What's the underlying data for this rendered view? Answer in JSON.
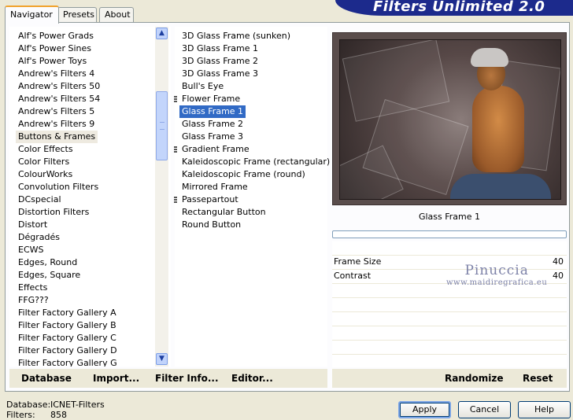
{
  "tabs": [
    {
      "label": "Navigator",
      "active": true
    },
    {
      "label": "Presets",
      "active": false
    },
    {
      "label": "About",
      "active": false
    }
  ],
  "banner": {
    "title": "Filters Unlimited 2.0"
  },
  "categories": {
    "items": [
      "Alf's Power Grads",
      "Alf's Power Sines",
      "Alf's Power Toys",
      "Andrew's Filters 4",
      "Andrew's Filters 50",
      "Andrew's Filters 54",
      "Andrew's Filters 5",
      "Andrew's Filters 9",
      "Buttons & Frames",
      "Color Effects",
      "Color Filters",
      "ColourWorks",
      "Convolution Filters",
      "DCspecial",
      "Distortion Filters",
      "Distort",
      "Dégradés",
      "ECWS",
      "Edges, Round",
      "Edges, Square",
      "Effects",
      "FFG???",
      "Filter Factory Gallery A",
      "Filter Factory Gallery B",
      "Filter Factory Gallery C",
      "Filter Factory Gallery D",
      "Filter Factory Gallery G"
    ],
    "selected": "Buttons & Frames"
  },
  "filters": {
    "items": [
      {
        "label": "3D Glass Frame (sunken)",
        "marked": false
      },
      {
        "label": "3D Glass Frame 1",
        "marked": false
      },
      {
        "label": "3D Glass Frame 2",
        "marked": false
      },
      {
        "label": "3D Glass Frame 3",
        "marked": false
      },
      {
        "label": "Bull's Eye",
        "marked": false
      },
      {
        "label": "Flower Frame",
        "marked": true
      },
      {
        "label": "Glass Frame 1",
        "marked": false
      },
      {
        "label": "Glass Frame 2",
        "marked": false
      },
      {
        "label": "Glass Frame 3",
        "marked": false
      },
      {
        "label": "Gradient Frame",
        "marked": true
      },
      {
        "label": "Kaleidoscopic Frame (rectangular)",
        "marked": false
      },
      {
        "label": "Kaleidoscopic Frame (round)",
        "marked": false
      },
      {
        "label": "Mirrored Frame",
        "marked": false
      },
      {
        "label": "Passepartout",
        "marked": true
      },
      {
        "label": "Rectangular Button",
        "marked": false
      },
      {
        "label": "Round Button",
        "marked": false
      }
    ],
    "selected": "Glass Frame 1"
  },
  "preview": {
    "filter_name": "Glass Frame 1"
  },
  "params": [
    {
      "label": "Frame Size",
      "value": "40"
    },
    {
      "label": "Contrast",
      "value": "40"
    }
  ],
  "watermark": {
    "line1": "Pinuccia",
    "line2": "www.maidiregrafica.eu"
  },
  "toolbar_left": {
    "database": "Database",
    "import": "Import...",
    "filter_info": "Filter Info...",
    "editor": "Editor..."
  },
  "toolbar_right": {
    "randomize": "Randomize",
    "reset": "Reset"
  },
  "status": {
    "database_label": "Database:",
    "database_value": "ICNET-Filters",
    "filters_label": "Filters:",
    "filters_value": "858"
  },
  "buttons": {
    "apply": "Apply",
    "cancel": "Cancel",
    "help": "Help"
  },
  "colors": {
    "accent": "#316ac5",
    "banner": "#1c2a8c",
    "tab_highlight": "#f1a22c"
  }
}
